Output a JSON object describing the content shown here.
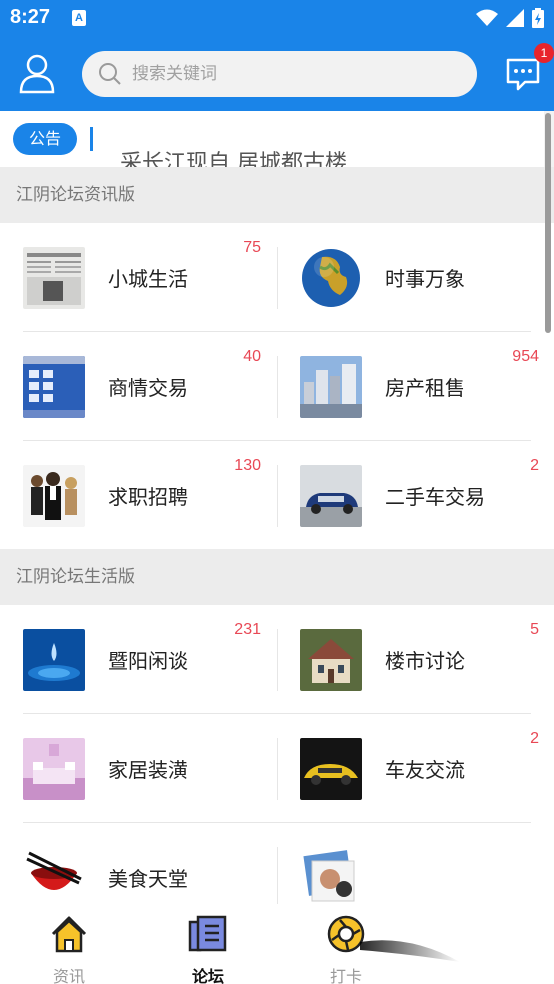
{
  "status_bar": {
    "time": "8:27",
    "notification_icon": "A"
  },
  "header": {
    "user_icon": "user-icon",
    "search": {
      "placeholder": "搜索关键词",
      "value": ""
    },
    "messages": {
      "icon": "chat-icon",
      "badge": "1"
    },
    "accent_color": "#1a84e8"
  },
  "notice": {
    "tag": "公告",
    "text": "采长江现自 居城都古楼"
  },
  "sections": [
    {
      "title": "江阴论坛资讯版",
      "items": [
        {
          "label": "小城生活",
          "count": "75",
          "thumb": "newspaper"
        },
        {
          "label": "时事万象",
          "count": "",
          "thumb": "globe"
        },
        {
          "label": "商情交易",
          "count": "40",
          "thumb": "desktop"
        },
        {
          "label": "房产租售",
          "count": "954",
          "thumb": "buildings"
        },
        {
          "label": "求职招聘",
          "count": "130",
          "thumb": "people"
        },
        {
          "label": "二手车交易",
          "count": "2",
          "thumb": "car-blue"
        }
      ]
    },
    {
      "title": "江阴论坛生活版",
      "items": [
        {
          "label": "暨阳闲谈",
          "count": "231",
          "thumb": "water-drop"
        },
        {
          "label": "楼市讨论",
          "count": "5",
          "thumb": "house"
        },
        {
          "label": "家居装潢",
          "count": "",
          "thumb": "bedroom"
        },
        {
          "label": "车友交流",
          "count": "2",
          "thumb": "sportscar"
        },
        {
          "label": "美食天堂",
          "count": "",
          "thumb": "bowl"
        },
        {
          "label": "",
          "count": "",
          "thumb": "photos"
        }
      ]
    }
  ],
  "bottom_nav": [
    {
      "label": "资讯",
      "icon": "home-icon",
      "active": false
    },
    {
      "label": "论坛",
      "icon": "forum-icon",
      "active": true
    },
    {
      "label": "打卡",
      "icon": "checkin-icon",
      "active": false
    }
  ],
  "colors": {
    "count": "#e84855",
    "section_bg": "#ececec"
  }
}
